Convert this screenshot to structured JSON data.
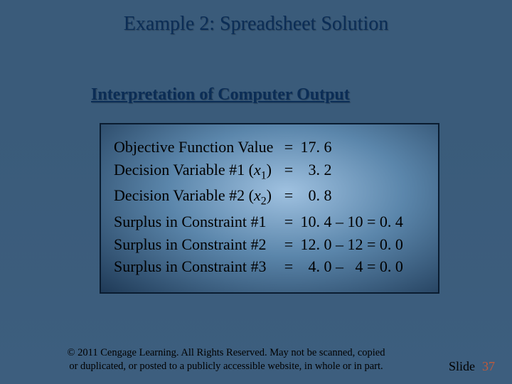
{
  "title": "Example 2:  Spreadsheet Solution",
  "subtitle": "Interpretation of Computer Output",
  "rows": {
    "r0": {
      "label_pre": "Objective Function Value",
      "eq": "=",
      "val": " 17. 6"
    },
    "r1": {
      "label_pre": "Decision Variable #1 (",
      "var": "x",
      "sub": "1",
      "label_post": ")",
      "eq": "=",
      "val": "   3. 2"
    },
    "r2": {
      "label_pre": "Decision Variable #2 (",
      "var": "x",
      "sub": "2",
      "label_post": ")",
      "eq": "=",
      "val": "   0. 8"
    },
    "r3": {
      "label_pre": "Surplus in Constraint #1",
      "eq": "=",
      "val": " 10. 4 – 10 = 0. 4"
    },
    "r4": {
      "label_pre": "Surplus in Constraint #2",
      "eq": "=",
      "val": " 12. 0 – 12 = 0. 0"
    },
    "r5": {
      "label_pre": "Surplus in Constraint #3",
      "eq": "=",
      "val": "   4. 0 –   4 = 0. 0"
    }
  },
  "footer": {
    "copyright_l1": "© 2011  Cengage Learning.  All Rights Reserved.  May not be scanned, copied",
    "copyright_l2": "or duplicated, or posted to a publicly accessible website, in whole or in part.",
    "slide_label": "Slide",
    "slide_number": "37"
  }
}
